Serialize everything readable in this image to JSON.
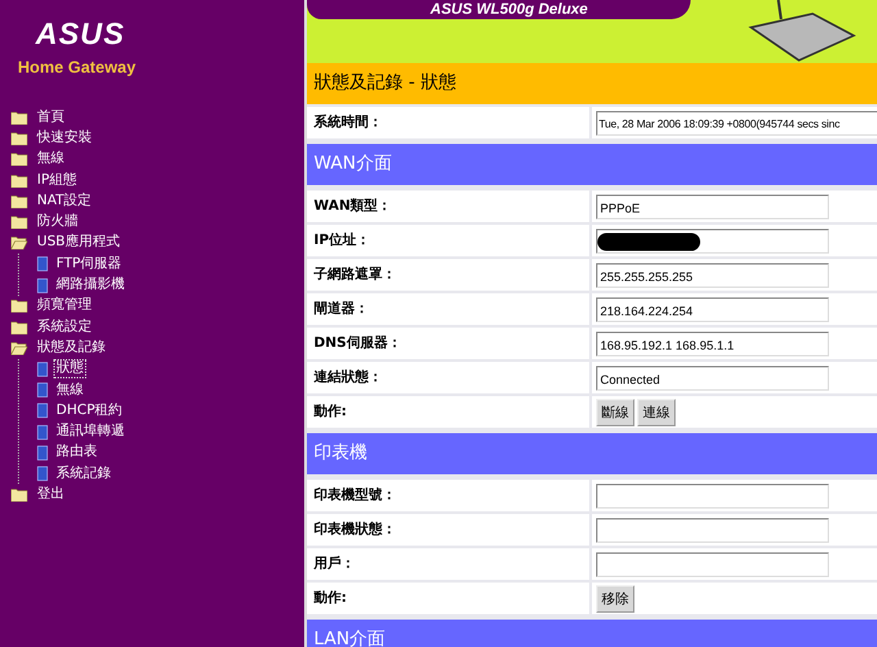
{
  "sidebar": {
    "logo": "ASUS",
    "subtitle": "Home Gateway",
    "items": [
      {
        "label": "首頁",
        "expanded": false,
        "selected": false
      },
      {
        "label": "快速安裝",
        "expanded": false,
        "selected": false
      },
      {
        "label": "無線",
        "expanded": false,
        "selected": false
      },
      {
        "label": "IP組態",
        "expanded": false,
        "selected": false
      },
      {
        "label": "NAT設定",
        "expanded": false,
        "selected": false
      },
      {
        "label": "防火牆",
        "expanded": false,
        "selected": false
      },
      {
        "label": "USB應用程式",
        "expanded": true,
        "selected": false,
        "children": [
          {
            "label": "FTP伺服器",
            "selected": false
          },
          {
            "label": "網路攝影機",
            "selected": false
          }
        ]
      },
      {
        "label": "頻寬管理",
        "expanded": false,
        "selected": false
      },
      {
        "label": "系統設定",
        "expanded": false,
        "selected": false
      },
      {
        "label": "狀態及記錄",
        "expanded": true,
        "selected": false,
        "children": [
          {
            "label": "狀態",
            "selected": true
          },
          {
            "label": "無線",
            "selected": false
          },
          {
            "label": "DHCP租約",
            "selected": false
          },
          {
            "label": "通訊埠轉遞",
            "selected": false
          },
          {
            "label": "路由表",
            "selected": false
          },
          {
            "label": "系統記錄",
            "selected": false
          }
        ]
      },
      {
        "label": "登出",
        "expanded": false,
        "selected": false
      }
    ]
  },
  "header": {
    "banner": "ASUS WL500g Deluxe"
  },
  "page_title": "狀態及記錄 - 狀態",
  "system_time": {
    "label": "系統時間：",
    "value": "Tue, 28 Mar 2006 18:09:39 +0800(945744 secs sinc"
  },
  "sections": [
    {
      "title": "WAN介面",
      "rows": [
        {
          "kind": "field",
          "label": "WAN類型：",
          "value": "PPPoE"
        },
        {
          "kind": "field",
          "label": "IP位址：",
          "redacted": true
        },
        {
          "kind": "field",
          "label": "子網路遮罩：",
          "value": "255.255.255.255"
        },
        {
          "kind": "field",
          "label": "閘道器：",
          "value": "218.164.224.254"
        },
        {
          "kind": "field",
          "label": "DNS伺服器：",
          "value": "168.95.192.1 168.95.1.1"
        },
        {
          "kind": "field",
          "label": "連結狀態：",
          "value": "Connected"
        },
        {
          "kind": "buttons",
          "label": "動作:",
          "buttons": [
            "斷線",
            "連線"
          ]
        }
      ]
    },
    {
      "title": "印表機",
      "rows": [
        {
          "kind": "field",
          "label": "印表機型號："
        },
        {
          "kind": "field",
          "label": "印表機狀態："
        },
        {
          "kind": "field",
          "label": "用戶："
        },
        {
          "kind": "buttons",
          "label": "動作:",
          "buttons": [
            "移除"
          ]
        }
      ]
    },
    {
      "title": "LAN介面"
    }
  ]
}
